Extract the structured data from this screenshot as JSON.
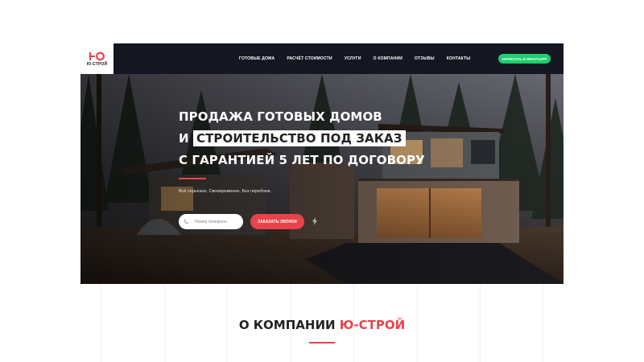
{
  "header": {
    "logo_text": "Ю-СТРОЙ",
    "nav": [
      "Готовые дома",
      "Расчёт стоимости",
      "Услуги",
      "О компании",
      "Отзывы",
      "Контакты"
    ],
    "whatsapp_button": "Написать в WhatsApp"
  },
  "hero": {
    "title_line1": "ПРОДАЖА ГОТОВЫХ ДОМОВ",
    "title_line2_prefix": "И",
    "title_line2_highlight": "СТРОИТЕЛЬСТВО ПОД ЗАКАЗ",
    "title_line3": "С ГАРАНТИЕЙ 5 ЛЕТ ПО ДОГОВОРУ",
    "subtitle": "Всё серьёзно. Своевременно. Без перебоев.",
    "phone_placeholder": "Номер телефона",
    "call_button": "Заказать звонок"
  },
  "about": {
    "title_prefix": "О КОМПАНИИ",
    "title_brand": "Ю-СТРОЙ"
  },
  "colors": {
    "header_bg": "#141722",
    "accent": "#e8434b",
    "whatsapp": "#1fce6d"
  },
  "icons": [
    "logo-mark-icon",
    "phone-icon",
    "bolt-icon"
  ]
}
